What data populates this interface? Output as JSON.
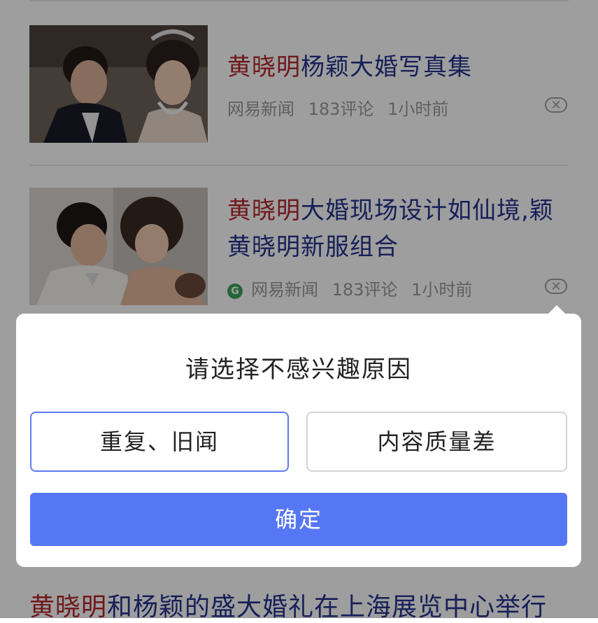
{
  "feed": {
    "items": [
      {
        "title_keyword": "黄晓明",
        "title_rest": "杨颖大婚写真集",
        "source": "网易新闻",
        "comments": "183评论",
        "time": "1小时前",
        "dismiss_icon": "close-icon"
      },
      {
        "title_keyword": "黄晓明",
        "title_rest_line1": "大婚现场设计如仙境,颖",
        "title_rest_line2": "黄晓明新服组合",
        "source_logo": "G",
        "source": "网易新闻",
        "comments": "183评论",
        "time": "1小时前",
        "dismiss_icon": "close-icon"
      }
    ],
    "bottom_item": {
      "title_keyword": "黄晓明",
      "title_rest": "和杨颖的盛大婚礼在上海展览中心举行"
    }
  },
  "dialog": {
    "title": "请选择不感兴趣原因",
    "reasons": [
      {
        "label": "重复、旧闻",
        "selected": true
      },
      {
        "label": "内容质量差",
        "selected": false
      }
    ],
    "confirm_label": "确定"
  },
  "colors": {
    "keyword": "#b3282c",
    "title": "#26338f",
    "meta": "#9a9a9a",
    "accent": "#5677f5"
  }
}
